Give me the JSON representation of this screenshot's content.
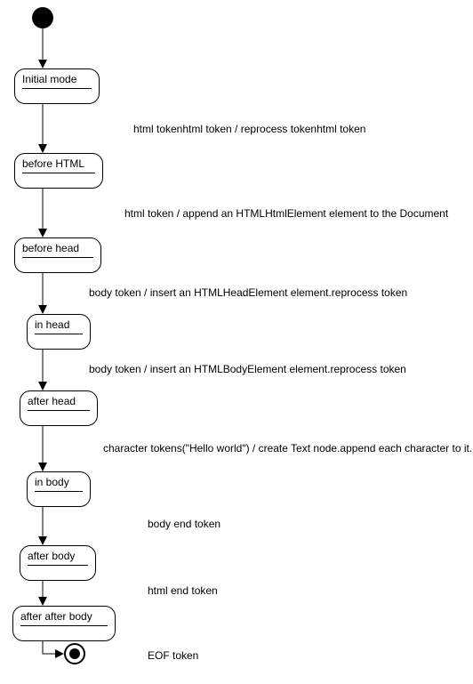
{
  "chart_data": {
    "type": "state-diagram",
    "start": true,
    "end": true,
    "states": [
      {
        "id": "initial-mode",
        "label": "Initial mode"
      },
      {
        "id": "before-html",
        "label": "before HTML"
      },
      {
        "id": "before-head",
        "label": "before head"
      },
      {
        "id": "in-head",
        "label": "in head"
      },
      {
        "id": "after-head",
        "label": "after head"
      },
      {
        "id": "in-body",
        "label": "in body"
      },
      {
        "id": "after-body",
        "label": "after body"
      },
      {
        "id": "after-after-body",
        "label": "after after body"
      }
    ],
    "transitions": [
      {
        "from": "start",
        "to": "initial-mode",
        "label": ""
      },
      {
        "from": "initial-mode",
        "to": "before-html",
        "label": "html tokenhtml token / reprocess tokenhtml token"
      },
      {
        "from": "before-html",
        "to": "before-head",
        "label": "html token / append an HTMLHtmlElement element to the Document"
      },
      {
        "from": "before-head",
        "to": "in-head",
        "label": "body token / insert an HTMLHeadElement element.reprocess token"
      },
      {
        "from": "in-head",
        "to": "after-head",
        "label": "body token / insert an HTMLBodyElement element.reprocess token"
      },
      {
        "from": "after-head",
        "to": "in-body",
        "label": "character tokens(\"Hello world\") / create Text node.append each character to it."
      },
      {
        "from": "in-body",
        "to": "after-body",
        "label": "body end token"
      },
      {
        "from": "after-body",
        "to": "after-after-body",
        "label": "html end token"
      },
      {
        "from": "after-after-body",
        "to": "end",
        "label": "EOF token"
      }
    ]
  }
}
